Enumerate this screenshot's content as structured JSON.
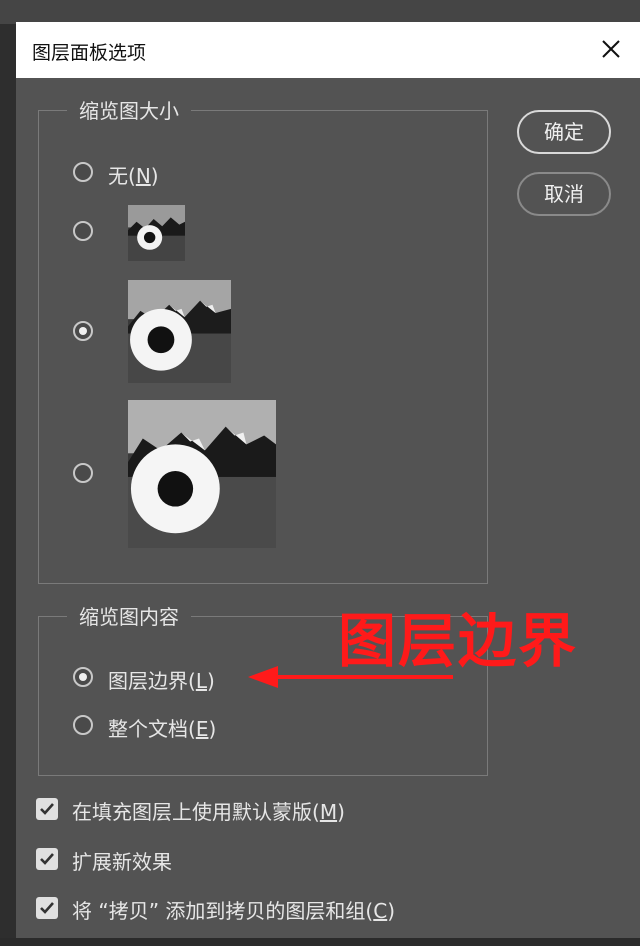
{
  "dialog": {
    "title": "图层面板选项",
    "close_icon": "close-icon"
  },
  "thumbnail_size": {
    "legend": "缩览图大小",
    "options": [
      {
        "label_main": "无(",
        "mnemonic": "N",
        "label_end": ")",
        "selected": false
      },
      {
        "size": "small",
        "selected": false
      },
      {
        "size": "medium",
        "selected": true
      },
      {
        "size": "large",
        "selected": false
      }
    ]
  },
  "thumbnail_content": {
    "legend": "缩览图内容",
    "options": [
      {
        "label_main": "图层边界(",
        "mnemonic": "L",
        "label_end": ")",
        "selected": true
      },
      {
        "label_main": "整个文档(",
        "mnemonic": "E",
        "label_end": ")",
        "selected": false
      }
    ]
  },
  "buttons": {
    "ok": "确定",
    "cancel": "取消"
  },
  "checkboxes": [
    {
      "label_main": "在填充图层上使用默认蒙版(",
      "mnemonic": "M",
      "label_end": ")",
      "checked": true
    },
    {
      "label_main": "扩展新效果",
      "mnemonic": "",
      "label_end": "",
      "checked": true
    },
    {
      "label_main": "将 “拷贝” 添加到拷贝的图层和组(",
      "mnemonic": "C",
      "label_end": ")",
      "checked": true
    }
  ],
  "annotation": {
    "text": "图层边界",
    "color": "#ff1a1a"
  }
}
